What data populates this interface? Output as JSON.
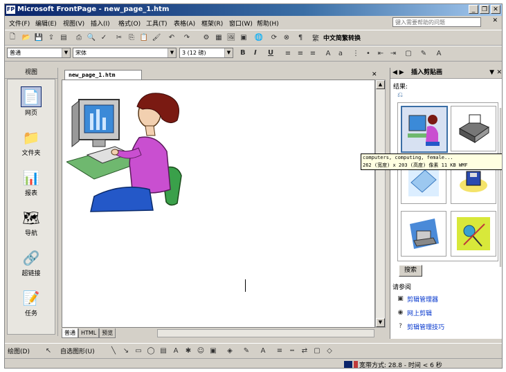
{
  "window": {
    "title": "Microsoft FrontPage - new_page_1.htm",
    "min": "_",
    "restore": "❐",
    "close": "✕"
  },
  "menu": {
    "items": [
      "文件(F)",
      "编辑(E)",
      "视图(V)",
      "插入(I)",
      "格式(O)",
      "工具(T)",
      "表格(A)",
      "框架(R)",
      "窗口(W)",
      "帮助(H)"
    ],
    "help_placeholder": "键入需要帮助的问题",
    "close_doc": "✕"
  },
  "toolbar_standard": {
    "language": "中文简繁转换"
  },
  "toolbar_formatting": {
    "style": "普通",
    "font": "宋体",
    "size": "3 (12 磅)"
  },
  "views": {
    "title": "视图",
    "items": [
      {
        "label": "网页",
        "icon": "page-view-icon",
        "selected": true
      },
      {
        "label": "文件夹",
        "icon": "folder-icon",
        "selected": false
      },
      {
        "label": "报表",
        "icon": "reports-icon",
        "selected": false
      },
      {
        "label": "导航",
        "icon": "navigation-icon",
        "selected": false
      },
      {
        "label": "超链接",
        "icon": "hyperlinks-icon",
        "selected": false
      },
      {
        "label": "任务",
        "icon": "tasks-icon",
        "selected": false
      }
    ]
  },
  "document": {
    "tab": "new_page_1.htm",
    "close": "✕",
    "view_tabs": [
      "普通",
      "HTML",
      "预览"
    ]
  },
  "taskpane": {
    "title": "插入剪贴画",
    "results_label": "结果:",
    "tooltip_line1": "computers, computing, female...",
    "tooltip_line2": "262 (宽度) x 203 (高度) 像素 11 KB WMF",
    "search_button": "搜索",
    "see_also": "请参阅",
    "links": [
      "剪辑管理器",
      "网上剪辑",
      "剪辑管理技巧"
    ]
  },
  "drawing": {
    "draw_label": "绘图(D)",
    "autoshapes_label": "自选图形(U)"
  },
  "status": {
    "text": "宽带方式: 28.8 - 时间 < 6 秒"
  },
  "colors": {
    "titlebar_start": "#0a246a",
    "titlebar_end": "#a6caf0",
    "chrome": "#d4d0c8",
    "link": "#0033cc",
    "tooltip_bg": "#ffffe1"
  }
}
